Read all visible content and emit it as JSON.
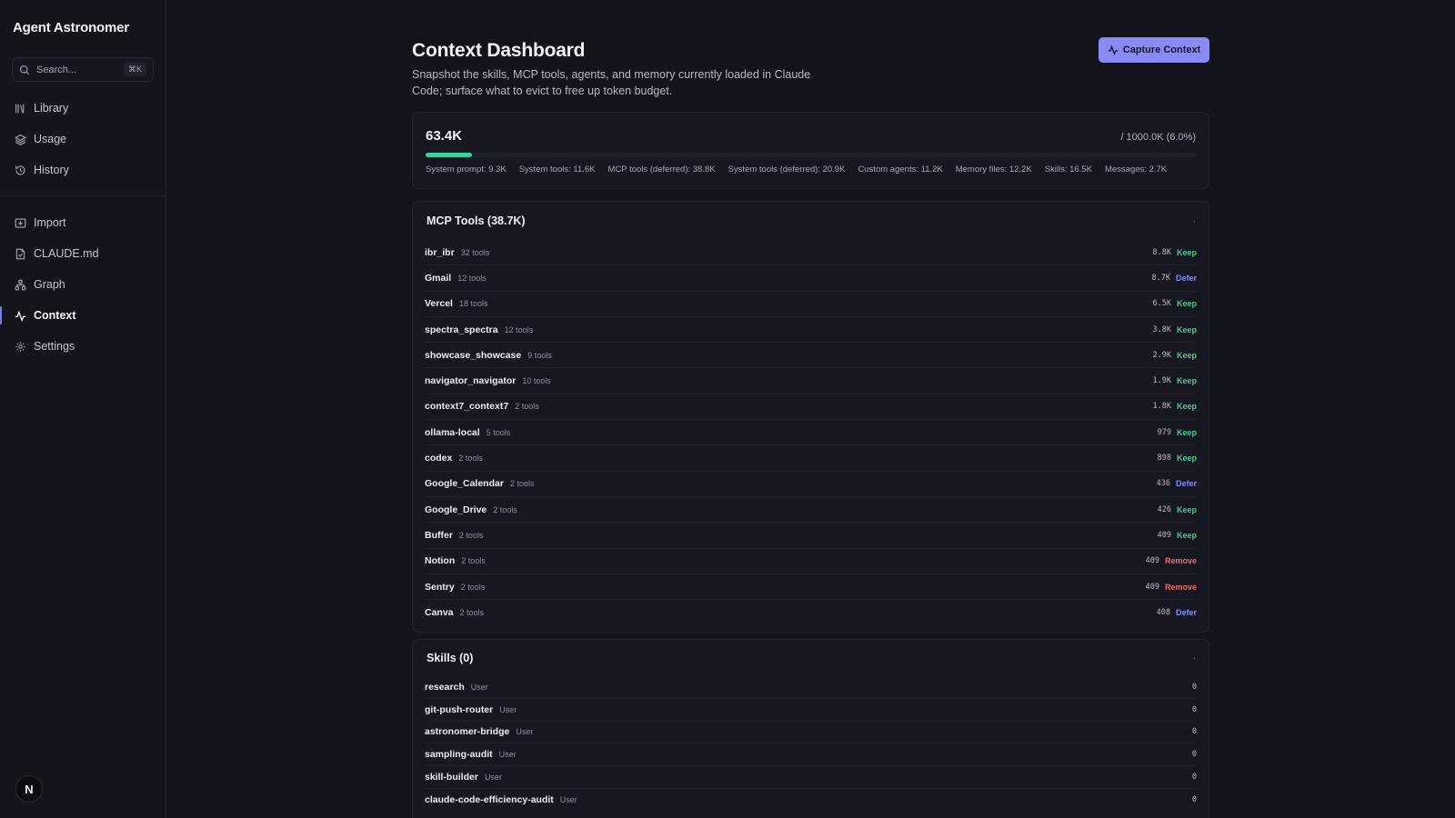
{
  "sidebar": {
    "app_title": "Agent Astronomer",
    "search": {
      "placeholder": "Search...",
      "shortcut": "⌘K"
    },
    "nav_top": [
      {
        "label": "Library",
        "icon": "library-icon"
      },
      {
        "label": "Usage",
        "icon": "layers-icon"
      },
      {
        "label": "History",
        "icon": "history-icon"
      }
    ],
    "nav_bottom": [
      {
        "label": "Import",
        "icon": "import-icon"
      },
      {
        "label": "CLAUDE.md",
        "icon": "file-icon"
      },
      {
        "label": "Graph",
        "icon": "graph-icon"
      },
      {
        "label": "Context",
        "icon": "activity-icon",
        "active": true
      },
      {
        "label": "Settings",
        "icon": "gear-icon"
      }
    ],
    "avatar_initial": "N"
  },
  "header": {
    "title": "Context Dashboard",
    "description": "Snapshot the skills, MCP tools, agents, and memory currently loaded in Claude Code; surface what to evict to free up token budget.",
    "capture_button": "Capture Context"
  },
  "usage": {
    "total": "63.4K",
    "capacity": "/ 1000.0K (6.0%)",
    "percent": 6.0,
    "breakdown": [
      "System prompt: 9.3K",
      "System tools: 11.6K",
      "MCP tools (deferred): 38.8K",
      "System tools (deferred): 20.9K",
      "Custom agents: 11.2K",
      "Memory files: 12.2K",
      "Skills: 16.5K",
      "Messages: 2.7K"
    ]
  },
  "mcp": {
    "title": "MCP Tools (38.7K)",
    "collapse": "·",
    "rows": [
      {
        "name": "ibr_ibr",
        "count": "32 tools",
        "tokens": "8.8K",
        "action": "Keep"
      },
      {
        "name": "Gmail",
        "count": "12 tools",
        "tokens": "8.7K",
        "action": "Defer"
      },
      {
        "name": "Vercel",
        "count": "18 tools",
        "tokens": "6.5K",
        "action": "Keep"
      },
      {
        "name": "spectra_spectra",
        "count": "12 tools",
        "tokens": "3.8K",
        "action": "Keep"
      },
      {
        "name": "showcase_showcase",
        "count": "9 tools",
        "tokens": "2.9K",
        "action": "Keep"
      },
      {
        "name": "navigator_navigator",
        "count": "10 tools",
        "tokens": "1.9K",
        "action": "Keep"
      },
      {
        "name": "context7_context7",
        "count": "2 tools",
        "tokens": "1.8K",
        "action": "Keep"
      },
      {
        "name": "ollama-local",
        "count": "5 tools",
        "tokens": "979",
        "action": "Keep"
      },
      {
        "name": "codex",
        "count": "2 tools",
        "tokens": "898",
        "action": "Keep"
      },
      {
        "name": "Google_Calendar",
        "count": "2 tools",
        "tokens": "436",
        "action": "Defer"
      },
      {
        "name": "Google_Drive",
        "count": "2 tools",
        "tokens": "426",
        "action": "Keep"
      },
      {
        "name": "Buffer",
        "count": "2 tools",
        "tokens": "409",
        "action": "Keep"
      },
      {
        "name": "Notion",
        "count": "2 tools",
        "tokens": "409",
        "action": "Remove"
      },
      {
        "name": "Sentry",
        "count": "2 tools",
        "tokens": "409",
        "action": "Remove"
      },
      {
        "name": "Canva",
        "count": "2 tools",
        "tokens": "408",
        "action": "Defer"
      }
    ]
  },
  "skills": {
    "title": "Skills (0)",
    "collapse": "·",
    "rows": [
      {
        "name": "research",
        "scope": "User",
        "tokens": "0"
      },
      {
        "name": "git-push-router",
        "scope": "User",
        "tokens": "0"
      },
      {
        "name": "astronomer-bridge",
        "scope": "User",
        "tokens": "0"
      },
      {
        "name": "sampling-audit",
        "scope": "User",
        "tokens": "0"
      },
      {
        "name": "skill-builder",
        "scope": "User",
        "tokens": "0"
      },
      {
        "name": "claude-code-efficiency-audit",
        "scope": "User",
        "tokens": "0"
      }
    ]
  },
  "colors": {
    "accent": "#8a8af5",
    "progress": "#3ccfa0",
    "keep": "#3ccf8e",
    "defer": "#7f8ef5",
    "remove": "#f26a6a"
  }
}
